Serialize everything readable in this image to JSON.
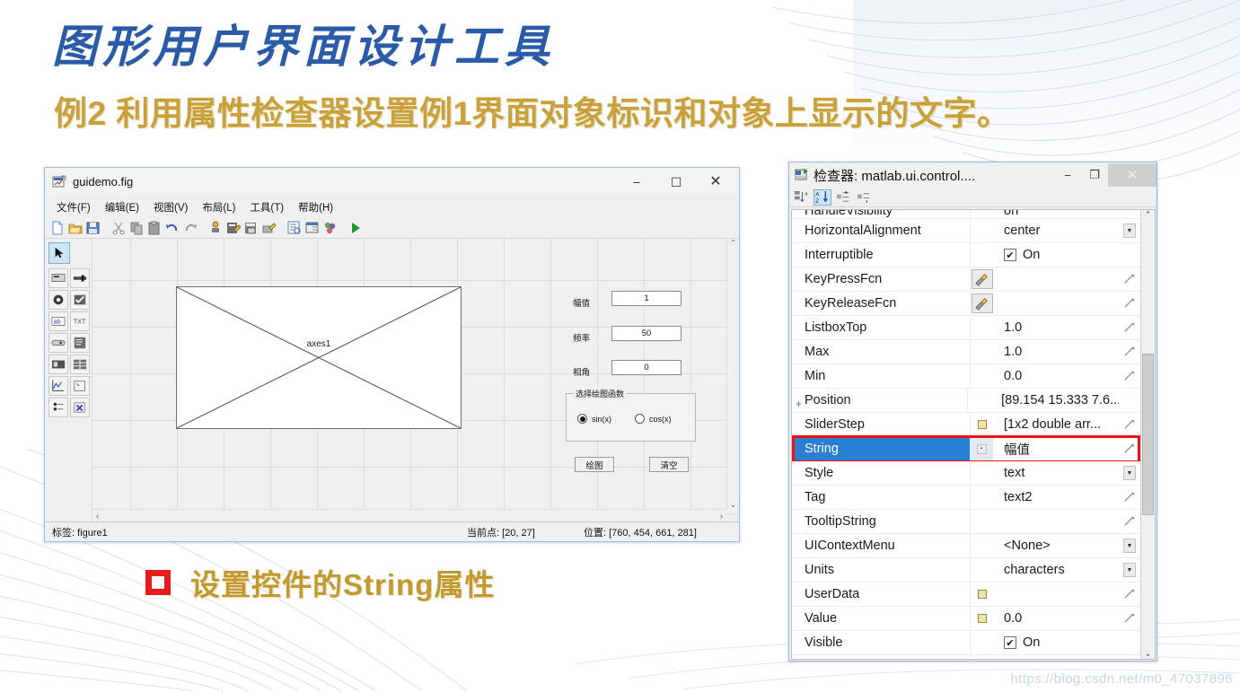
{
  "slide": {
    "title": "图形用户界面设计工具",
    "subtitle": "例2  利用属性检查器设置例1界面对象标识和对象上显示的文字。",
    "bullet_text": "设置控件的String属性",
    "watermark": "https://blog.csdn.net/m0_47037896",
    "colors": {
      "title": "#2a5ba8",
      "subtitle": "#c8a13c",
      "bullet_mark": "#e81b1b",
      "highlight": "#ee1111",
      "selection": "#2a7fd4"
    }
  },
  "guide_window": {
    "title": "guidemo.fig",
    "title_icon": "figure-icon",
    "window_buttons": {
      "minimize": "−",
      "maximize": "☐",
      "close": "✕"
    },
    "menus": [
      "文件(F)",
      "编辑(E)",
      "视图(V)",
      "布局(L)",
      "工具(T)",
      "帮助(H)"
    ],
    "toolbar": [
      "new-icon",
      "open-icon",
      "save-icon",
      "cut-icon",
      "copy-icon",
      "paste-icon",
      "undo-icon",
      "redo-icon",
      "align-objects-icon",
      "menu-editor-icon",
      "toolbar-editor-icon",
      "mfile-editor-icon",
      "object-browser-icon",
      "property-inspector-icon",
      "grid-rulers-icon",
      "run-icon"
    ],
    "palette": {
      "cursor_tool": "select-arrow-icon",
      "components": [
        "push-button-icon",
        "slider-icon",
        "radio-button-icon",
        "checkbox-icon",
        "edit-text-icon",
        "static-text-icon",
        "popup-menu-icon",
        "listbox-icon",
        "toggle-button-icon",
        "table-icon",
        "axes-icon",
        "panel-icon",
        "button-group-icon",
        "activex-icon"
      ]
    },
    "canvas": {
      "axes_label": "axes1",
      "labels": [
        {
          "name": "amplitude-label",
          "text": "幅值"
        },
        {
          "name": "frequency-label",
          "text": "频率"
        },
        {
          "name": "phase-label",
          "text": "相角"
        }
      ],
      "edits": [
        {
          "name": "amplitude-edit",
          "value": "1"
        },
        {
          "name": "frequency-edit",
          "value": "50"
        },
        {
          "name": "phase-edit",
          "value": "0"
        }
      ],
      "panel": {
        "title": "选择绘图函数",
        "radios": [
          {
            "label": "sin(x)",
            "selected": true
          },
          {
            "label": "cos(x)",
            "selected": false
          }
        ]
      },
      "buttons": [
        {
          "name": "plot-button",
          "label": "绘图"
        },
        {
          "name": "clear-button",
          "label": "清空"
        }
      ]
    },
    "statusbar": {
      "label": "标签: figure1",
      "current_point": "当前点: [20, 27]",
      "position": "位置: [760, 454, 661, 281]"
    },
    "scroll_arrows": {
      "up": "⌃",
      "down": "⌄",
      "left": "‹",
      "right": "›"
    }
  },
  "inspector_window": {
    "title": "检查器: matlab.ui.control....",
    "title_icon": "inspector-icon",
    "window_buttons": {
      "minimize": "−",
      "restore": "❐",
      "close": "✕"
    },
    "toolbar": [
      {
        "name": "sort-by-category-button",
        "icon": "category-sort-icon",
        "active": false
      },
      {
        "name": "sort-alphabetical-button",
        "icon": "alpha-sort-icon",
        "active": true
      },
      {
        "name": "expand-all-button",
        "icon": "expand-all-icon",
        "active": false
      },
      {
        "name": "collapse-all-button",
        "icon": "collapse-all-icon",
        "active": false
      }
    ],
    "clipped_top_row": {
      "name": "HandleVisibility",
      "value": "on"
    },
    "rows": [
      {
        "name": "HorizontalAlignment",
        "value": "center",
        "control": "combo",
        "expander": false
      },
      {
        "name": "Interruptible",
        "value": "On",
        "control": "checkbox",
        "checked": true,
        "expander": false
      },
      {
        "name": "KeyPressFcn",
        "value": "",
        "control": "function-handle",
        "expander": false,
        "pencil": true
      },
      {
        "name": "KeyReleaseFcn",
        "value": "",
        "control": "function-handle",
        "expander": false,
        "pencil": true
      },
      {
        "name": "ListboxTop",
        "value": "1.0",
        "control": "text",
        "expander": false,
        "pencil": true
      },
      {
        "name": "Max",
        "value": "1.0",
        "control": "text",
        "expander": false,
        "pencil": true
      },
      {
        "name": "Min",
        "value": "0.0",
        "control": "text",
        "expander": false,
        "pencil": true
      },
      {
        "name": "Position",
        "value": "[89.154 15.333 7.6...",
        "control": "text",
        "expander": true,
        "pencil": false
      },
      {
        "name": "SliderStep",
        "value": "[1x2  double arr...",
        "control": "text",
        "expander": false,
        "square": true,
        "pencil": true
      },
      {
        "name": "String",
        "value": "幅值",
        "control": "text",
        "expander": false,
        "selected": true,
        "highlighted": true,
        "pencil": true
      },
      {
        "name": "Style",
        "value": "text",
        "control": "combo",
        "expander": false
      },
      {
        "name": "Tag",
        "value": "text2",
        "control": "text",
        "expander": false,
        "pencil": true
      },
      {
        "name": "TooltipString",
        "value": "",
        "control": "text",
        "expander": false,
        "pencil": true
      },
      {
        "name": "UIContextMenu",
        "value": "<None>",
        "control": "combo",
        "expander": false
      },
      {
        "name": "Units",
        "value": "characters",
        "control": "combo",
        "expander": false
      },
      {
        "name": "UserData",
        "value": "",
        "control": "text",
        "expander": false,
        "square": true,
        "pencil": true
      },
      {
        "name": "Value",
        "value": "0.0",
        "control": "text",
        "expander": false,
        "square": true,
        "pencil": true
      },
      {
        "name": "Visible",
        "value": "On",
        "control": "checkbox",
        "checked": true,
        "expander": false
      }
    ],
    "scroll_arrows": {
      "up": "⌃",
      "down": "⌄"
    }
  }
}
